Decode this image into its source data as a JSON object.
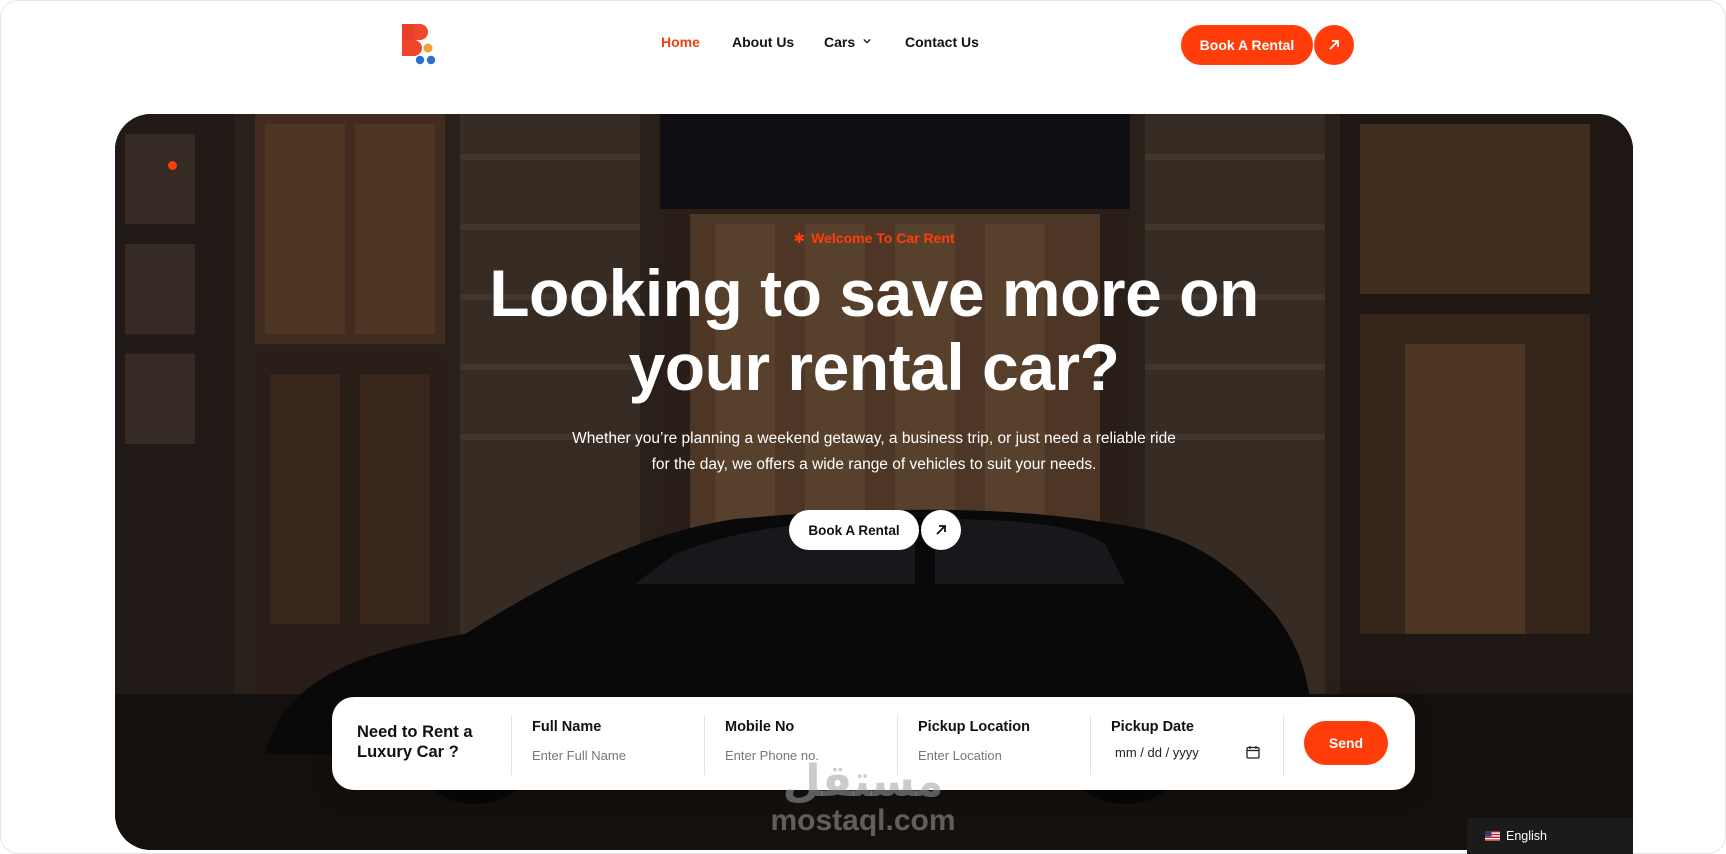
{
  "nav": {
    "items": [
      {
        "label": "Home",
        "active": true
      },
      {
        "label": "About Us",
        "active": false
      },
      {
        "label": "Cars",
        "active": false
      },
      {
        "label": "Contact Us",
        "active": false
      }
    ],
    "cta_label": "Book A Rental",
    "cars_icon": "chevron-down-icon",
    "cta_icon": "arrow-up-right-icon"
  },
  "hero": {
    "eyebrow": "Welcome To Car Rent",
    "eyebrow_icon": "asterisk-icon",
    "title_line1": "Looking to save more on",
    "title_line2": "your rental car?",
    "subtitle_line1": "Whether you’re planning a weekend getaway, a business trip, or just need a reliable ride",
    "subtitle_line2": "for the day, we offers a wide range of vehicles to suit your needs.",
    "cta_label": "Book A Rental",
    "cta_icon": "arrow-up-right-icon"
  },
  "booking": {
    "heading": "Need to Rent a Luxury Car ?",
    "fields": [
      {
        "label": "Full Name",
        "placeholder": "Enter Full Name"
      },
      {
        "label": "Mobile No",
        "placeholder": "Enter Phone no."
      },
      {
        "label": "Pickup Location",
        "placeholder": "Enter Location"
      },
      {
        "label": "Pickup Date",
        "value": "mm / dd / yyyy",
        "icon": "calendar-icon"
      }
    ],
    "submit_label": "Send"
  },
  "watermark": {
    "arabic": "مستقل",
    "latin": "mostaql.com"
  },
  "language": {
    "label": "English",
    "flag_icon": "us-flag-icon"
  },
  "colors": {
    "accent": "#ff3d0a",
    "text_dark": "#111111",
    "white": "#ffffff"
  }
}
